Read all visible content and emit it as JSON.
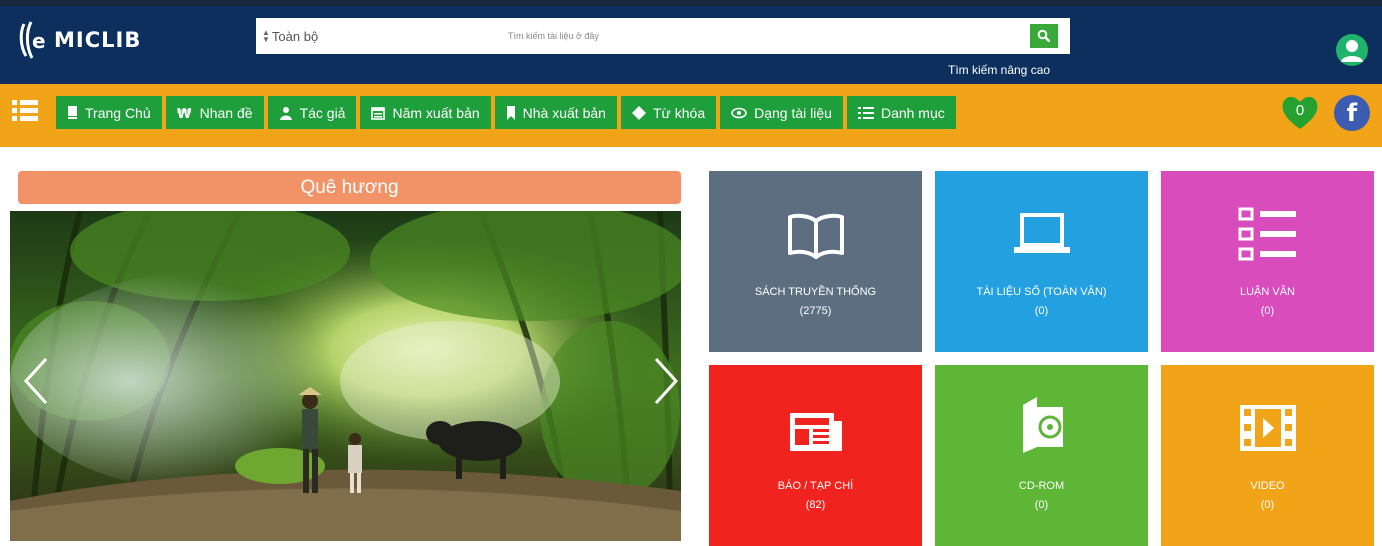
{
  "header": {
    "logo_text": "MICLIB",
    "search": {
      "scope": "Toàn bộ",
      "placeholder": "Tìm kiếm tài liệu ở đây"
    },
    "advanced_search": "Tìm kiếm nâng cao"
  },
  "nav": {
    "items": [
      {
        "label": "Trang Chủ",
        "icon": "book-icon"
      },
      {
        "label": "Nhan đề",
        "icon": "title-icon"
      },
      {
        "label": "Tác giả",
        "icon": "author-icon"
      },
      {
        "label": "Năm xuất bản",
        "icon": "calendar-icon"
      },
      {
        "label": "Nhà xuất bản",
        "icon": "bookmark-icon"
      },
      {
        "label": "Từ khóa",
        "icon": "keyword-icon"
      },
      {
        "label": "Dạng tài liệu",
        "icon": "doctype-icon"
      },
      {
        "label": "Danh mục",
        "icon": "list-icon"
      }
    ],
    "favorites_count": "0"
  },
  "slider": {
    "title": "Quê hương"
  },
  "tiles": [
    {
      "label": "SÁCH TRUYỀN THỐNG",
      "count": "(2775)",
      "icon": "open-book-icon",
      "color": "#5d6e80"
    },
    {
      "label": "TÀI LIỆU SỐ (TOÀN VĂN)",
      "count": "(0)",
      "icon": "laptop-icon",
      "color": "#22a0e0"
    },
    {
      "label": "LUẬN VĂN",
      "count": "(0)",
      "icon": "list-icon",
      "color": "#d84dbb"
    },
    {
      "label": "BÁO / TẠP CHÍ",
      "count": "(82)",
      "icon": "newspaper-icon",
      "color": "#f1231e"
    },
    {
      "label": "CD-ROM",
      "count": "(0)",
      "icon": "cd-icon",
      "color": "#5db635"
    },
    {
      "label": "VIDEO",
      "count": "(0)",
      "icon": "film-icon",
      "color": "#f2a418"
    }
  ],
  "colors": {
    "header_bg": "#0d2f5e",
    "navbar_bg": "#f2a418",
    "nav_button": "#1f9e3c",
    "slide_title_bg": "#f19367"
  }
}
